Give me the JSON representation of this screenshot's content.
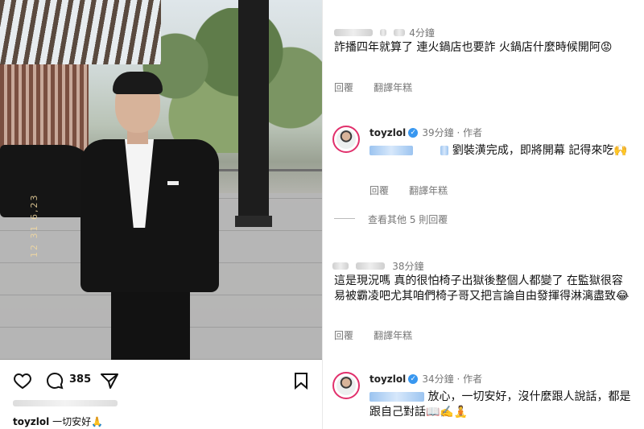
{
  "post": {
    "like_count": "385",
    "caption_user": "toyzlol",
    "caption_text": "一切安好🙏"
  },
  "comments": [
    {
      "time": "4分鐘",
      "text": "詐播四年就算了 連火鍋店也要詐 火鍋店什麼時候開阿😡",
      "reply": "回覆",
      "translate": "翻譯年糕"
    },
    {
      "user": "toyzlol",
      "time": "39分鐘",
      "role": "作者",
      "text_after_mention": "劉裝潢完成，即將開幕 記得來吃🙌",
      "reply": "回覆",
      "translate": "翻譯年糕"
    },
    {
      "view_more": "查看其他 5 則回覆"
    },
    {
      "time": "38分鐘",
      "text": "這是現況嗎 真的很怕椅子出獄後整個人都變了 在監獄很容易被霸凌吧尤其咱們椅子哥又把言論自由發揮得淋漓盡致😂",
      "reply": "回覆",
      "translate": "翻譯年糕"
    },
    {
      "user": "toyzlol",
      "time": "34分鐘",
      "role": "作者",
      "text_after_mention": "放心，一切安好，沒什麼跟人說話，都是跟自己對話📖✍️🧘"
    }
  ],
  "photo_watermark": "12 31 6,23",
  "colors": {
    "verified": "#3897f0",
    "story_ring": "#e1306c",
    "meta": "#777777"
  },
  "icons": [
    "heart-icon",
    "comment-icon",
    "share-icon",
    "bookmark-icon",
    "verified-badge-icon"
  ]
}
